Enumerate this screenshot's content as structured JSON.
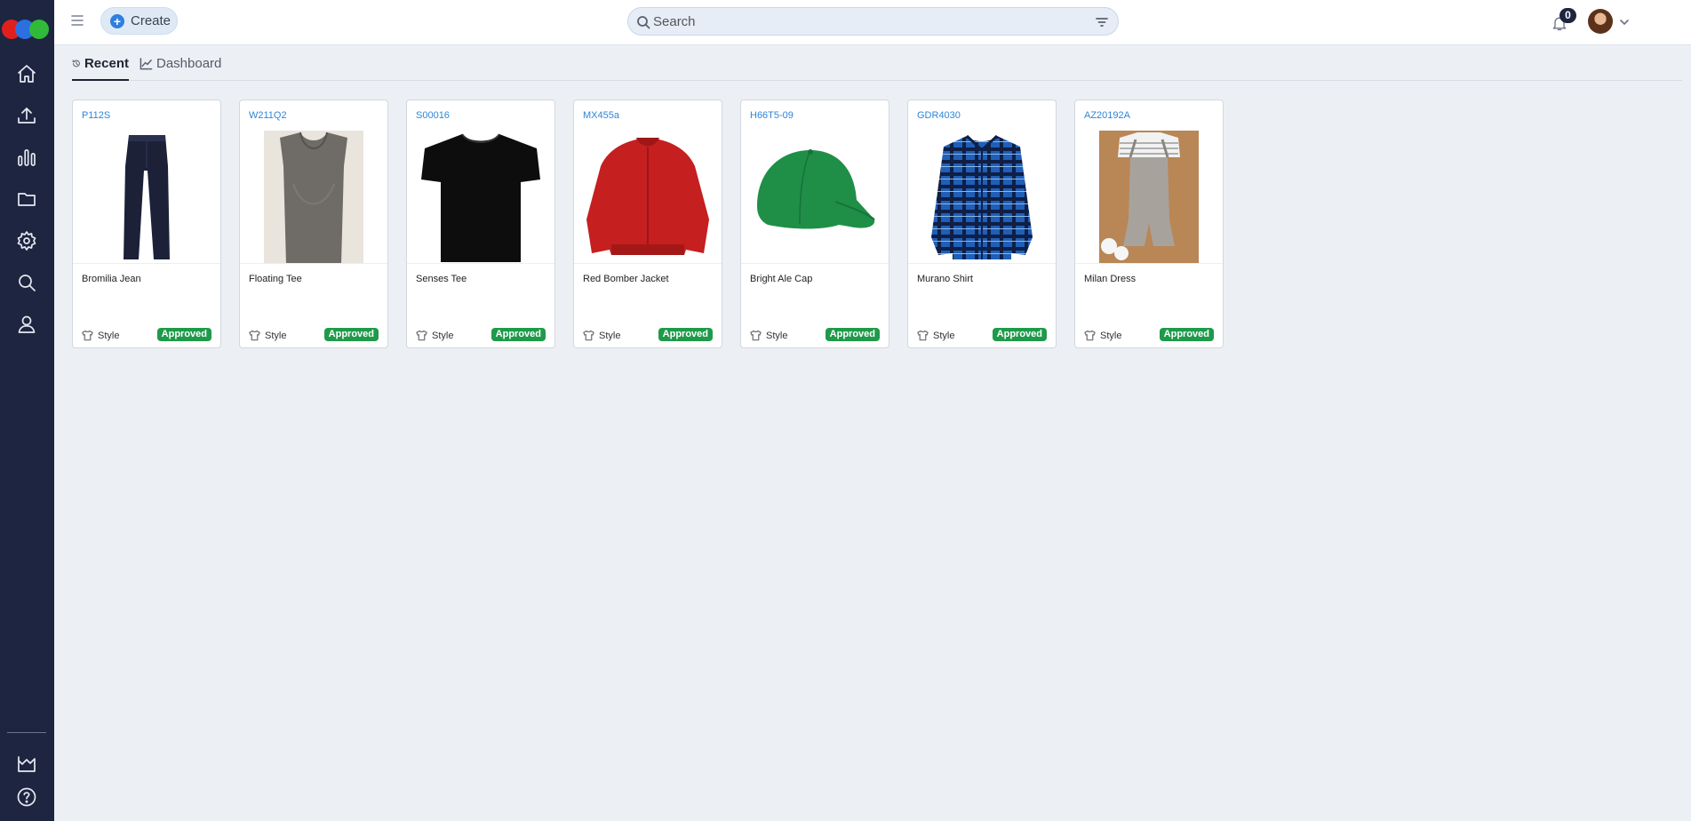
{
  "app": {
    "create_label": "Create",
    "search_placeholder": "Search",
    "notification_count": "0"
  },
  "tabs": [
    {
      "label": "Recent",
      "active": true
    },
    {
      "label": "Dashboard",
      "active": false
    }
  ],
  "cards": [
    {
      "code": "P112S",
      "name": "Bromilia Jean",
      "type": "Style",
      "status": "Approved",
      "image": "dark-jeans"
    },
    {
      "code": "W211Q2",
      "name": "Floating Tee",
      "type": "Style",
      "status": "Approved",
      "image": "gray-tee"
    },
    {
      "code": "S00016",
      "name": "Senses Tee",
      "type": "Style",
      "status": "Approved",
      "image": "black-tee"
    },
    {
      "code": "MX455a",
      "name": "Red Bomber Jacket",
      "type": "Style",
      "status": "Approved",
      "image": "red-jacket"
    },
    {
      "code": "H66T5-09",
      "name": "Bright Ale Cap",
      "type": "Style",
      "status": "Approved",
      "image": "green-cap"
    },
    {
      "code": "GDR4030",
      "name": "Murano Shirt",
      "type": "Style",
      "status": "Approved",
      "image": "blue-plaid-shirt"
    },
    {
      "code": "AZ20192A",
      "name": "Milan Dress",
      "type": "Style",
      "status": "Approved",
      "image": "kids-overall"
    }
  ],
  "colors": {
    "sidebar": "#1d2540",
    "accent": "#2f86d8",
    "approved": "#1f9a4a",
    "logo": [
      "#e0201f",
      "#2b6fe0",
      "#31b93a"
    ]
  }
}
